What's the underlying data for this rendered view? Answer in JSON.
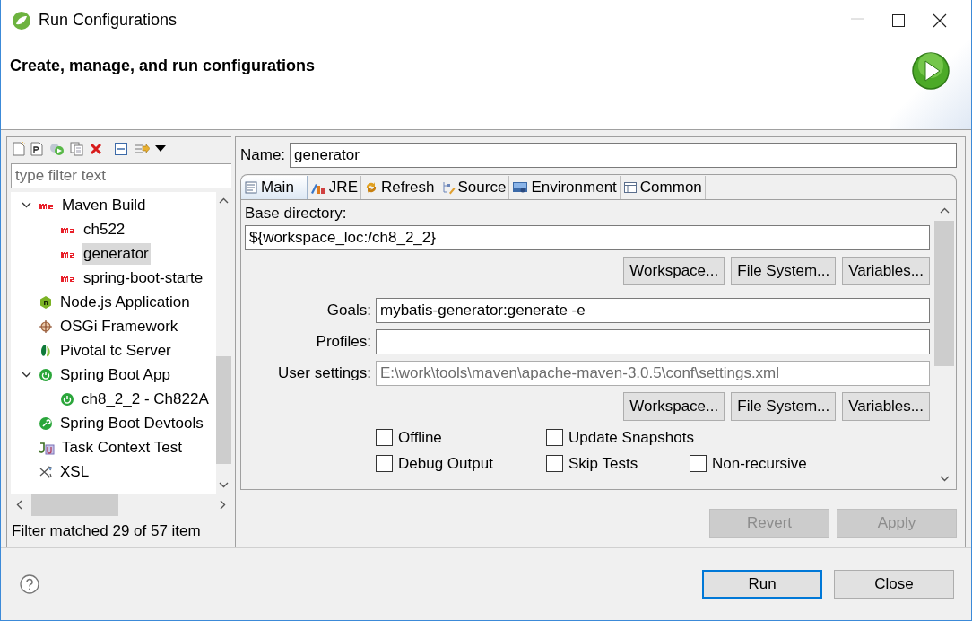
{
  "window": {
    "title": "Run Configurations"
  },
  "header": {
    "title": "Create, manage, and run configurations"
  },
  "sidebar": {
    "filter": {
      "placeholder": "type filter text"
    },
    "tree": [
      {
        "label": "Maven Build",
        "kind": "maven",
        "expanded": true,
        "selected": false,
        "children": [
          {
            "label": "ch522",
            "kind": "maven",
            "selected": false
          },
          {
            "label": "generator",
            "kind": "maven",
            "selected": true
          },
          {
            "label": "spring-boot-starte",
            "kind": "maven",
            "selected": false
          }
        ]
      },
      {
        "label": "Node.js Application",
        "kind": "nodejs",
        "selected": false
      },
      {
        "label": "OSGi Framework",
        "kind": "osgi",
        "selected": false
      },
      {
        "label": "Pivotal tc Server",
        "kind": "pivotal",
        "selected": false
      },
      {
        "label": "Spring Boot App",
        "kind": "spring",
        "expanded": true,
        "selected": false,
        "children": [
          {
            "label": "ch8_2_2 - Ch822A",
            "kind": "spring",
            "selected": false
          }
        ]
      },
      {
        "label": "Spring Boot Devtools",
        "kind": "devtools",
        "selected": false
      },
      {
        "label": "Task Context Test",
        "kind": "junit",
        "selected": false
      },
      {
        "label": "XSL",
        "kind": "xsl",
        "selected": false
      }
    ],
    "status": "Filter matched 29 of 57 item"
  },
  "editor": {
    "name": {
      "label": "Name:",
      "value": "generator"
    },
    "tabs": [
      {
        "label": "Main",
        "kind": "main",
        "selected": true
      },
      {
        "label": "JRE",
        "kind": "jre",
        "selected": false
      },
      {
        "label": "Refresh",
        "kind": "refresh",
        "selected": false
      },
      {
        "label": "Source",
        "kind": "source",
        "selected": false
      },
      {
        "label": "Environment",
        "kind": "environment",
        "selected": false
      },
      {
        "label": "Common",
        "kind": "common",
        "selected": false
      }
    ],
    "base_directory": {
      "label": "Base directory:",
      "value": "${workspace_loc:/ch8_2_2}",
      "buttons": [
        "Workspace...",
        "File System...",
        "Variables..."
      ]
    },
    "fields": [
      {
        "label": "Goals:",
        "value": "mybatis-generator:generate -e",
        "dimmed": false
      },
      {
        "label": "Profiles:",
        "dimmed": false
      },
      {
        "label": "User settings:",
        "value": "E:\\work\\tools\\maven\\apache-maven-3.0.5\\conf\\settings.xml",
        "dimmed": true
      }
    ],
    "settings_buttons": [
      "Workspace...",
      "File System...",
      "Variables..."
    ],
    "checkbox_rows": [
      [
        {
          "label": "Offline",
          "checked": false
        },
        {
          "label": "Update Snapshots",
          "checked": false
        }
      ],
      [
        {
          "label": "Debug Output",
          "checked": false
        },
        {
          "label": "Skip Tests",
          "checked": false
        },
        {
          "label": "Non-recursive",
          "checked": false
        }
      ]
    ],
    "actions": [
      {
        "label": "Revert",
        "disabled": true
      },
      {
        "label": "Apply",
        "disabled": true
      }
    ]
  },
  "footer": {
    "buttons": [
      {
        "label": "Run",
        "default": true
      },
      {
        "label": "Close",
        "default": false
      }
    ]
  }
}
